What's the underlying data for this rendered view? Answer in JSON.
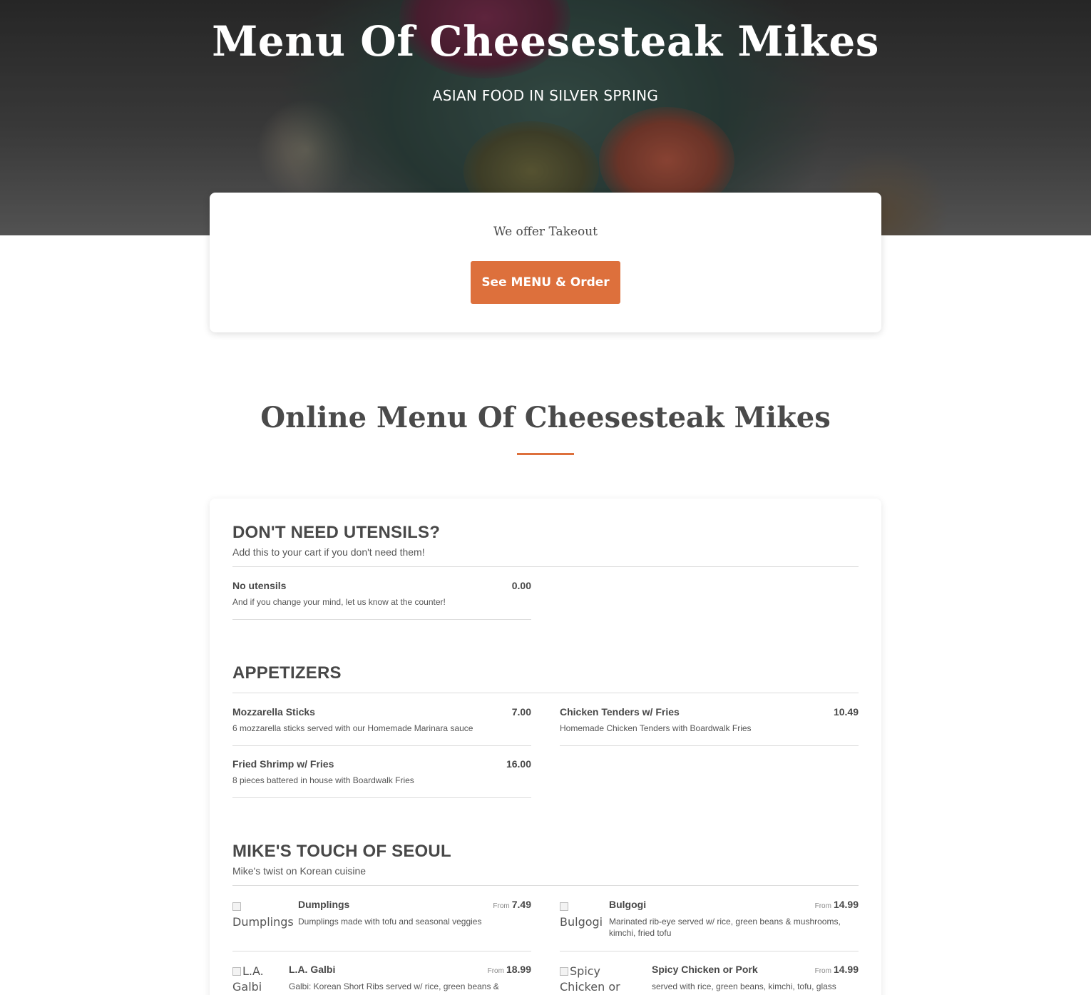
{
  "hero": {
    "title": "Menu Of Cheesesteak Mikes",
    "subtitle": "ASIAN FOOD IN SILVER SPRING"
  },
  "takeout": {
    "text": "We offer Takeout",
    "button_label": "See MENU & Order"
  },
  "menu_heading": "Online Menu Of Cheesesteak Mikes",
  "colors": {
    "accent": "#dd703c",
    "text": "#4a4a4a"
  },
  "categories": [
    {
      "title": "DON'T NEED UTENSILS?",
      "description": "Add this to your cart if you don't need them!",
      "items": [
        {
          "name": "No utensils",
          "price": "0.00",
          "description": "And if you change your mind, let us know at the counter!"
        }
      ]
    },
    {
      "title": "APPETIZERS",
      "items": [
        {
          "name": "Mozzarella Sticks",
          "price": "7.00",
          "description": "6 mozzarella sticks served with our Homemade Marinara sauce"
        },
        {
          "name": "Chicken Tenders w/ Fries",
          "price": "10.49",
          "description": "Homemade Chicken Tenders with Boardwalk Fries"
        },
        {
          "name": "Fried Shrimp w/ Fries",
          "price": "16.00",
          "description": "8 pieces battered in house with Boardwalk Fries"
        }
      ]
    },
    {
      "title": "MIKE'S TOUCH OF SEOUL",
      "description": "Mike's twist on Korean cuisine",
      "items": [
        {
          "name": "Dumplings",
          "price_prefix": "From",
          "price": "7.49",
          "description": "Dumplings made with tofu and seasonal veggies",
          "image_alt": "Dumplings"
        },
        {
          "name": "Bulgogi",
          "price_prefix": "From",
          "price": "14.99",
          "description": "Marinated rib-eye served w/ rice, green beans & mushrooms, kimchi, fried tofu",
          "image_alt": "Bulgogi"
        },
        {
          "name": "L.A. Galbi",
          "price_prefix": "From",
          "price": "18.99",
          "description": "Galbi: Korean Short Ribs served w/ rice, green beans &",
          "image_alt": "L.A. Galbi"
        },
        {
          "name": "Spicy Chicken or Pork",
          "price_prefix": "From",
          "price": "14.99",
          "description": "served with rice, green beans, kimchi, tofu, glass",
          "image_alt": "Spicy Chicken or Pork"
        }
      ]
    }
  ]
}
